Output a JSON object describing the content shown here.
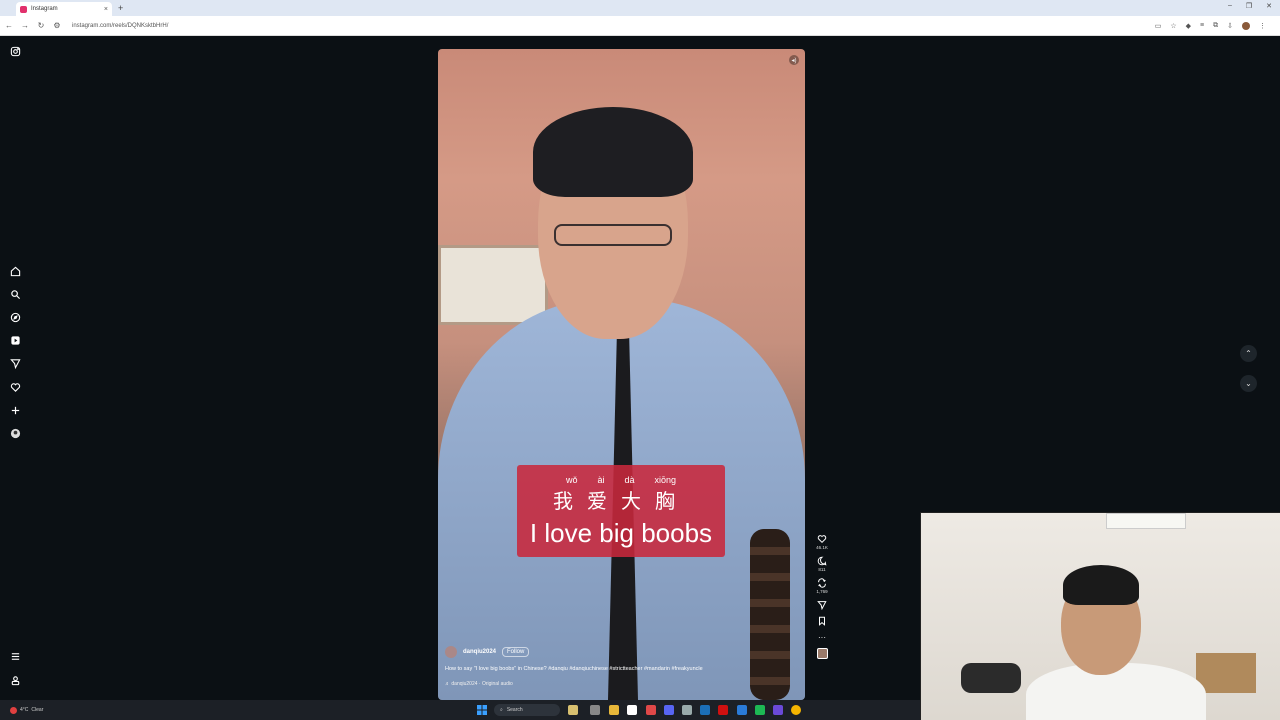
{
  "browser": {
    "tab_title": "Instagram",
    "tab_close": "×",
    "new_tab": "+",
    "window_controls": [
      "–",
      "❐",
      "✕"
    ],
    "url": "instagram.com/reels/DQNKsktbHrH/"
  },
  "sidebar": {
    "items": [
      "instagram-logo",
      "home",
      "search",
      "explore",
      "reels",
      "messages",
      "notifications",
      "create",
      "profile",
      "more",
      "also-from-meta"
    ]
  },
  "reel": {
    "subtitle": {
      "pinyin": [
        "wǒ",
        "ài",
        "dà",
        "xiōng"
      ],
      "hanzi": "我爱大胸",
      "english": "I love big boobs"
    },
    "username": "danqiu2024",
    "follow_label": "Follow",
    "caption": "How to say \"I love big boobs\" in Chinese? #danqiu #danqiuchinese #strictteacher #mandarin #freakyuncle",
    "audio": "♬ danqiu2024 · Original audio",
    "likes": "46.1K",
    "comments": "811",
    "reposts": "1,769",
    "more": "···"
  },
  "nav": {
    "up": "⌃",
    "down": "⌄"
  },
  "taskbar": {
    "weather_temp": "4°C",
    "weather_desc": "Clear",
    "search_placeholder": "Search"
  },
  "colors": {
    "subtitle_bg": "#c8283c",
    "page_bg": "#0b1014"
  }
}
